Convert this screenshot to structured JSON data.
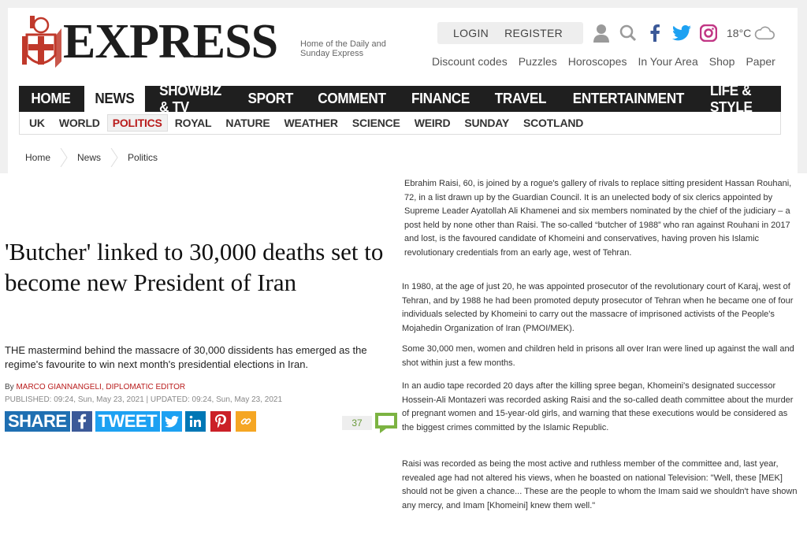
{
  "brand": {
    "name": "EXPRESS",
    "tagline": "Home of the Daily and Sunday Express"
  },
  "account": {
    "login": "LOGIN",
    "register": "REGISTER",
    "temperature": "18°C"
  },
  "icons": [
    "user-icon",
    "search-icon",
    "facebook-icon",
    "twitter-icon",
    "instagram-icon",
    "cloud-icon"
  ],
  "util_links": [
    "Discount codes",
    "Puzzles",
    "Horoscopes",
    "In Your Area",
    "Shop",
    "Paper"
  ],
  "nav": {
    "items": [
      "HOME",
      "NEWS",
      "SHOWBIZ & TV",
      "SPORT",
      "COMMENT",
      "FINANCE",
      "TRAVEL",
      "ENTERTAINMENT",
      "LIFE & STYLE"
    ],
    "active": "NEWS"
  },
  "subnav": {
    "items": [
      "UK",
      "WORLD",
      "POLITICS",
      "ROYAL",
      "NATURE",
      "WEATHER",
      "SCIENCE",
      "WEIRD",
      "SUNDAY",
      "SCOTLAND"
    ],
    "active": "POLITICS"
  },
  "breadcrumb": [
    "Home",
    "News",
    "Politics"
  ],
  "article": {
    "headline": "'Butcher' linked to 30,000 deaths set to become new President of Iran",
    "standfirst": "THE mastermind behind the massacre of 30,000 dissidents has emerged as the regime's favourite to win next month's presidential elections in Iran.",
    "byline_prefix": "By",
    "author": "MARCO GIANNANGELI, DIPLOMATIC EDITOR",
    "dates": "PUBLISHED: 09:24, Sun, May 23, 2021 | UPDATED: 09:24, Sun, May 23, 2021",
    "share_label": "SHARE",
    "tweet_label": "TWEET",
    "comment_count": "37"
  },
  "colors": {
    "brand_red": "#b91c1c",
    "nav_bg": "#1f1f1f",
    "share_blue": "#1f6fb2",
    "twitter_blue": "#1da1f2",
    "facebook_blue": "#3b5998",
    "linkedin_blue": "#0077b5",
    "pinterest_red": "#cb2027",
    "link_orange": "#f5a623",
    "comment_green": "#6a9a3a"
  },
  "body": [
    "Ebrahim Raisi, 60, is joined by a rogue's gallery of rivals to replace sitting president Hassan Rouhani, 72, in a list drawn up by the Guardian Council. It is an unelected body of six clerics appointed by Supreme Leader Ayatollah Ali Khamenei and six members nominated by the chief of the judiciary – a post held by none other than Raisi. The so-called “butcher of 1988” who ran against Rouhani in 2017 and lost, is the favoured candidate of Khomeini and conservatives, having proven his Islamic revolutionary credentials from an early age, west of Tehran.",
    "In 1980, at the age of just 20, he was appointed prosecutor of the revolutionary court of Karaj, west of Tehran, and by 1988 he had been promoted deputy prosecutor of Tehran when he became one of four individuals selected by Khomeini to carry out the massacre of imprisoned activists of the People's Mojahedin Organization of Iran (PMOI/MEK).",
    "Some 30,000 men, women and children held in prisons all over Iran were lined up against the wall and shot within just a few months.",
    "In an audio tape recorded 20 days after the killing spree began, Khomeini's designated successor Hossein-Ali Montazeri was recorded asking Raisi and the so-called death committee about the murder of pregnant women and 15-year-old girls, and warning that these executions would be considered as the biggest crimes committed by the Islamic Republic.",
    "Raisi was recorded as being the most active and ruthless member of the committee and, last year, revealed age had not altered his views, when he boasted on national Television: \"Well, these [MEK] should not be given a chance... These are the people to whom the Imam said we shouldn't have shown any mercy, and Imam [Khomeini] knew them well.\""
  ]
}
